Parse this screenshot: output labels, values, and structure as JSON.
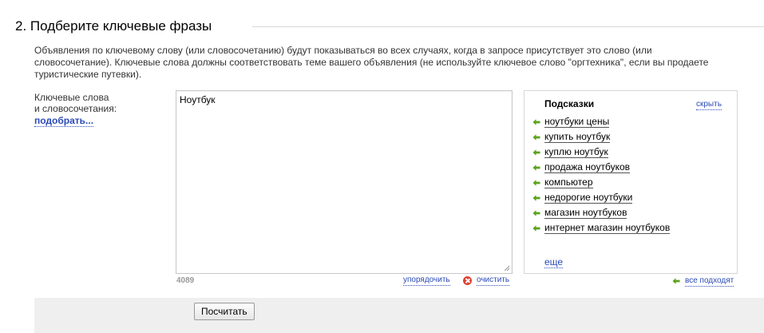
{
  "section": {
    "title": "2. Подберите ключевые фразы"
  },
  "description": "Объявления по ключевому слову (или словосочетанию) будут показываться во всех случаях, когда в запросе присутствует это слово (или словосочетание). Ключевые слова должны соответствовать теме вашего объявления (не используйте ключевое слово \"оргтехника\", если вы продаете туристические путевки).",
  "keywords": {
    "label_line1": "Ключевые слова",
    "label_line2": "и словосочетания:",
    "pick_link": "подобрать...",
    "value": "Ноутбук",
    "counter": "4089",
    "sort_link": "упорядочить",
    "clear_link": "очистить"
  },
  "hints": {
    "title": "Подсказки",
    "hide_link": "скрыть",
    "items": [
      "ноутбуки цены",
      "купить ноутбук",
      "куплю ноутбук",
      "продажа ноутбуков",
      "компьютер",
      "недорогие ноутбуки",
      "магазин ноутбуков",
      "интернет магазин ноутбуков"
    ],
    "more_link": "еще",
    "all_fit_link": "все подходят"
  },
  "actions": {
    "calculate_button": "Посчитать"
  },
  "colors": {
    "link": "#2b4ab8",
    "arrow": "#5aa31a",
    "clear_icon": "#e04030",
    "bottom_bar": "#efefef"
  },
  "icons": {
    "hint_add": "green-left-arrow-icon",
    "clear": "red-x-circle-icon",
    "resize": "resize-grip-icon"
  }
}
